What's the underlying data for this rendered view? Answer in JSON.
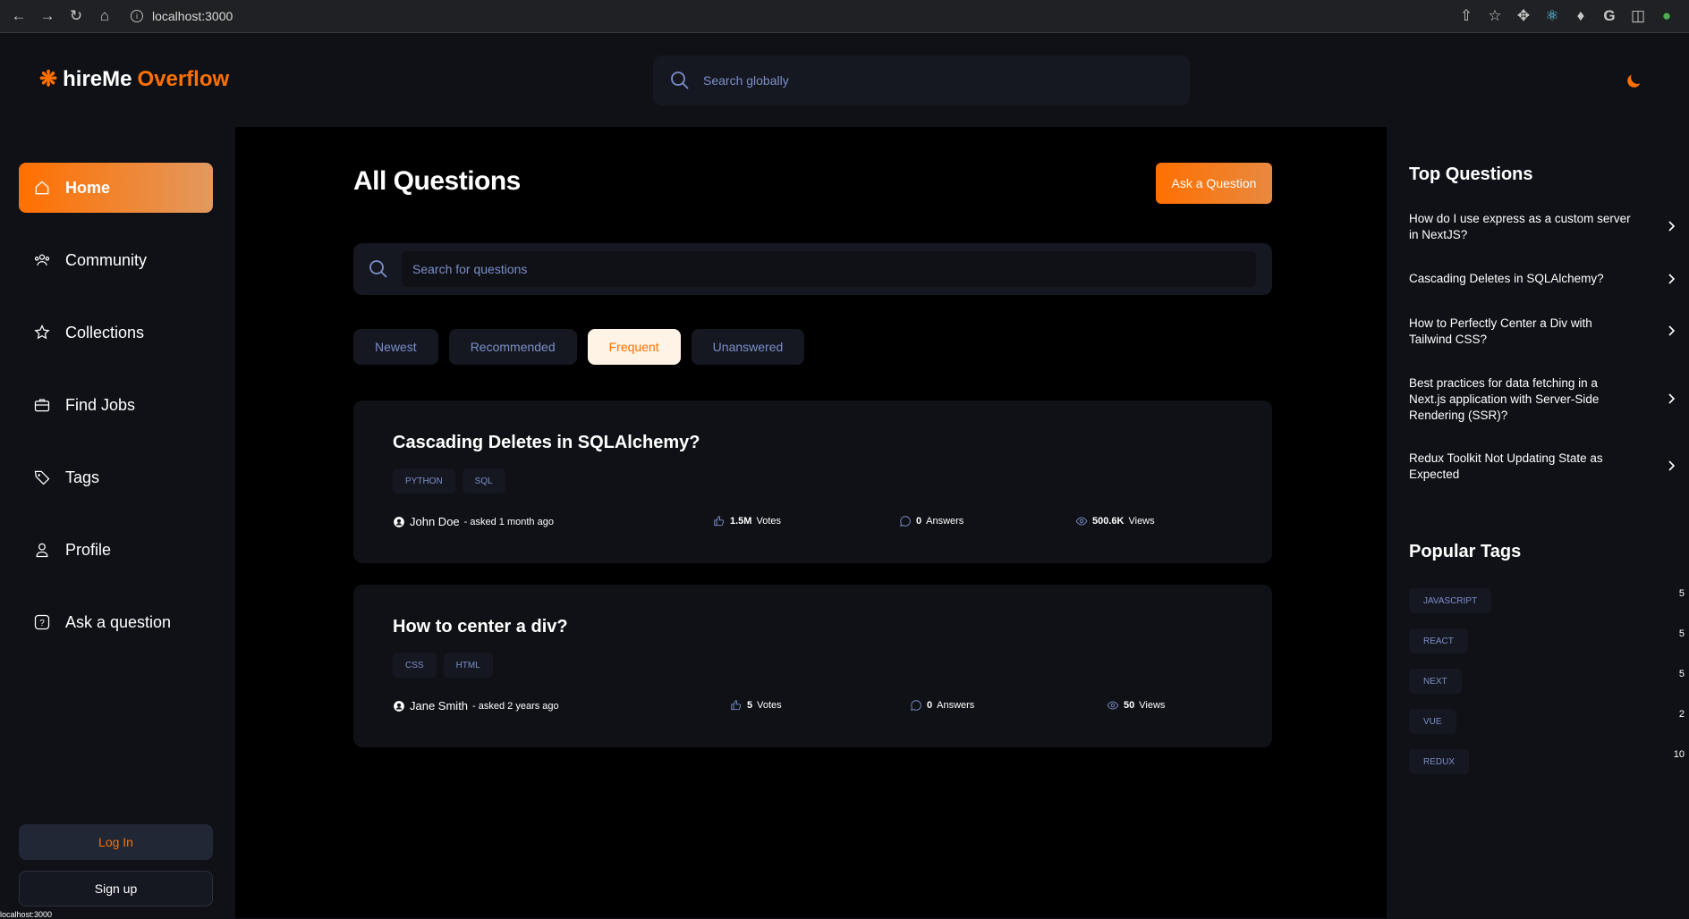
{
  "browser": {
    "url": "localhost:3000"
  },
  "header": {
    "logo_part1": "hireMe",
    "logo_part2": "Overflow",
    "search_placeholder": "Search globally"
  },
  "sidebar": {
    "items": [
      {
        "label": "Home",
        "icon": "home-icon",
        "active": true
      },
      {
        "label": "Community",
        "icon": "users-icon",
        "active": false
      },
      {
        "label": "Collections",
        "icon": "star-icon",
        "active": false
      },
      {
        "label": "Find Jobs",
        "icon": "briefcase-icon",
        "active": false
      },
      {
        "label": "Tags",
        "icon": "tag-icon",
        "active": false
      },
      {
        "label": "Profile",
        "icon": "user-icon",
        "active": false
      },
      {
        "label": "Ask a question",
        "icon": "question-icon",
        "active": false
      }
    ],
    "login_label": "Log In",
    "signup_label": "Sign up",
    "status_text": "localhost:3000"
  },
  "main": {
    "title": "All Questions",
    "ask_button": "Ask a Question",
    "search_placeholder": "Search for questions",
    "filters": [
      {
        "label": "Newest",
        "selected": false
      },
      {
        "label": "Recommended",
        "selected": false
      },
      {
        "label": "Frequent",
        "selected": true
      },
      {
        "label": "Unanswered",
        "selected": false
      }
    ],
    "questions": [
      {
        "title": "Cascading Deletes in SQLAlchemy?",
        "tags": [
          "PYTHON",
          "SQL"
        ],
        "author": "John Doe",
        "asked": "- asked 1 month ago",
        "votes": "1.5M",
        "votes_label": "Votes",
        "answers": "0",
        "answers_label": "Answers",
        "views": "500.6K",
        "views_label": "Views"
      },
      {
        "title": "How to center a div?",
        "tags": [
          "CSS",
          "HTML"
        ],
        "author": "Jane Smith",
        "asked": "- asked 2 years ago",
        "votes": "5",
        "votes_label": "Votes",
        "answers": "0",
        "answers_label": "Answers",
        "views": "50",
        "views_label": "Views"
      }
    ]
  },
  "right": {
    "top_title": "Top Questions",
    "top_questions": [
      "How do I use express as a custom server in NextJS?",
      "Cascading Deletes in SQLAlchemy?",
      "How to Perfectly Center a Div with Tailwind CSS?",
      "Best practices for data fetching in a Next.js application with Server-Side Rendering (SSR)?",
      "Redux Toolkit Not Updating State as Expected"
    ],
    "tags_title": "Popular Tags",
    "popular_tags": [
      {
        "name": "JAVASCRIPT",
        "count": "5"
      },
      {
        "name": "REACT",
        "count": "5"
      },
      {
        "name": "NEXT",
        "count": "5"
      },
      {
        "name": "VUE",
        "count": "2"
      },
      {
        "name": "REDUX",
        "count": "10"
      }
    ]
  },
  "colors": {
    "accent": "#ff7000",
    "background": "#0f1117",
    "main_bg": "#000000",
    "card_bg": "#0f1117",
    "muted_text": "#7b8ec8"
  }
}
